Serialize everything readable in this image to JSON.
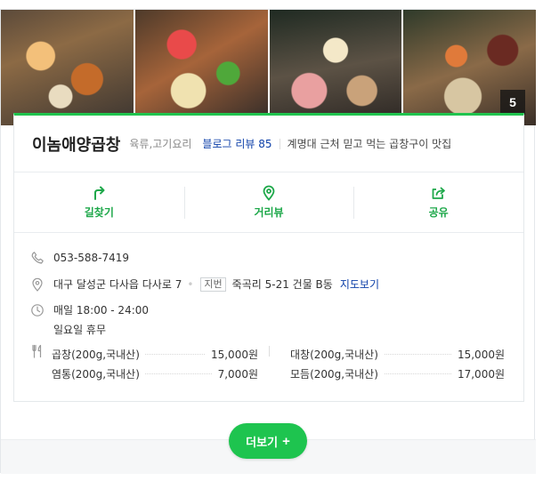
{
  "photos": {
    "items": [
      {
        "name": "photo-1"
      },
      {
        "name": "photo-2"
      },
      {
        "name": "photo-3"
      },
      {
        "name": "photo-4"
      }
    ],
    "count": "5"
  },
  "place": {
    "name": "이놈애양곱창",
    "category": "육류,고기요리",
    "blog_review": "블로그 리뷰 85",
    "description": "계명대 근처 믿고 먹는 곱창구이 맛집"
  },
  "actions": [
    {
      "label": "길찾기",
      "icon": "directions-icon"
    },
    {
      "label": "거리뷰",
      "icon": "location-pin-icon"
    },
    {
      "label": "공유",
      "icon": "share-icon"
    }
  ],
  "info": {
    "phone": "053-588-7419",
    "address": "대구 달성군 다사읍 다사로 7",
    "jibun_badge": "지번",
    "jibun_address": "죽곡리 5-21 건물 B동",
    "map_link": "지도보기",
    "hours": "매일 18:00 - 24:00",
    "holiday": "일요일 휴무"
  },
  "menu": [
    {
      "name": "곱창(200g,국내산)",
      "price": "15,000원"
    },
    {
      "name": "대창(200g,국내산)",
      "price": "15,000원"
    },
    {
      "name": "염통(200g,국내산)",
      "price": "7,000원"
    },
    {
      "name": "모듬(200g,국내산)",
      "price": "17,000원"
    }
  ],
  "more_button": {
    "label": "더보기",
    "plus": "+"
  },
  "colors": {
    "accent": "#20c34e",
    "link": "#0b3ea8"
  }
}
